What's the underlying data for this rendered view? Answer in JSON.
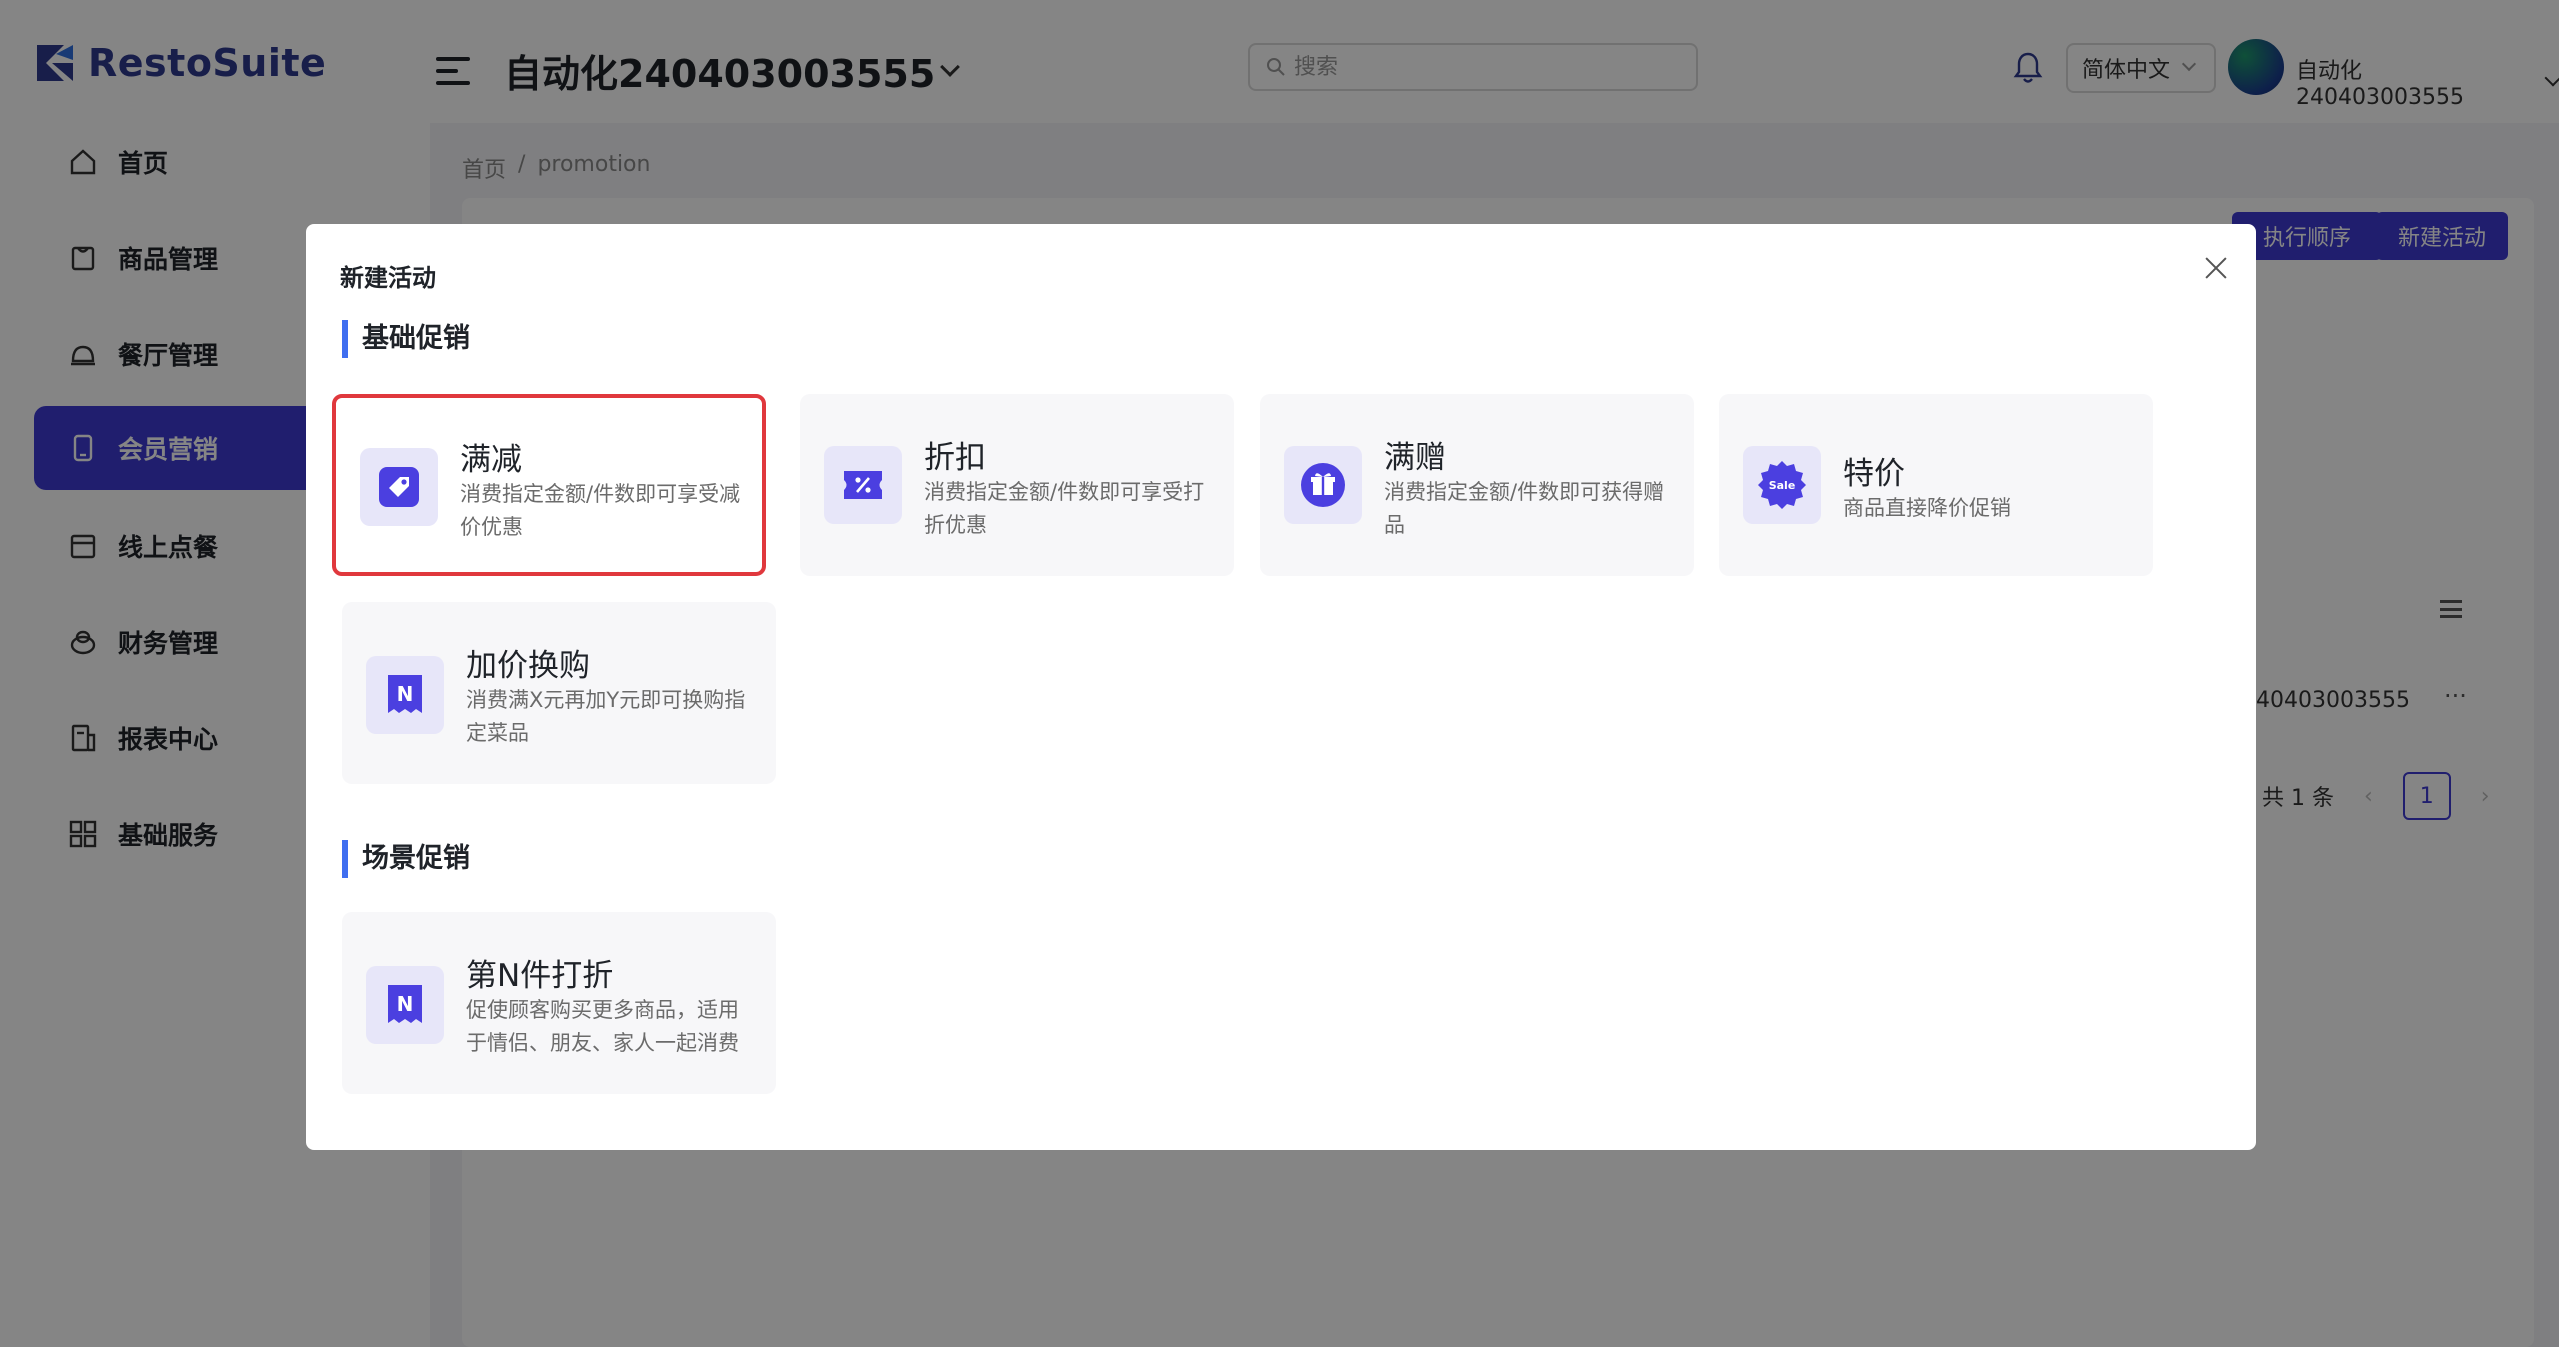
{
  "app": {
    "logo_text": "RestoSuite"
  },
  "header": {
    "store_title": "自动化240403003555",
    "search_placeholder": "搜索",
    "language": "简体中文",
    "user_name": "自动化240403003555"
  },
  "sidebar": {
    "items": [
      {
        "label": "首页",
        "icon": "home-icon"
      },
      {
        "label": "商品管理",
        "icon": "product-icon"
      },
      {
        "label": "餐厅管理",
        "icon": "restaurant-icon"
      },
      {
        "label": "会员营销",
        "icon": "member-icon",
        "active": true
      },
      {
        "label": "线上点餐",
        "icon": "online-order-icon"
      },
      {
        "label": "财务管理",
        "icon": "finance-icon"
      },
      {
        "label": "报表中心",
        "icon": "report-icon"
      },
      {
        "label": "基础服务",
        "icon": "grid-icon"
      }
    ]
  },
  "breadcrumb": {
    "home": "首页",
    "separator": "/",
    "current": "promotion"
  },
  "page": {
    "exec_order_label": "执行顺序",
    "new_activity_label": "新建活动",
    "row_store": "240403003555",
    "row_more": "···",
    "total_label": "共 1 条",
    "current_page": "1"
  },
  "modal": {
    "title": "新建活动",
    "sections": [
      {
        "title": "基础促销",
        "cards": [
          {
            "title": "满减",
            "desc": "消费指定金额/件数即可享受减价优惠",
            "icon": "price-tag-icon",
            "selected": true
          },
          {
            "title": "折扣",
            "desc": "消费指定金额/件数即可享受打折优惠",
            "icon": "percent-coupon-icon"
          },
          {
            "title": "满赠",
            "desc": "消费指定金额/件数即可获得赠品",
            "icon": "gift-icon"
          },
          {
            "title": "特价",
            "desc": "商品直接降价促销",
            "icon": "sale-badge-icon",
            "icon_text": "Sale"
          },
          {
            "title": "加价换购",
            "desc": "消费满X元再加Y元即可换购指定菜品",
            "icon": "n-ticket-icon",
            "icon_text": "N"
          }
        ]
      },
      {
        "title": "场景促销",
        "cards": [
          {
            "title": "第N件打折",
            "desc": "促使顾客购买更多商品，适用于情侣、朋友、家人一起消费",
            "icon": "n-ticket-icon",
            "icon_text": "N"
          }
        ]
      }
    ]
  },
  "colors": {
    "primary": "#3f3bd3",
    "selected_border": "#e0383d",
    "section_bar": "#3f6ef0",
    "icon_bg": "#e7e6f9"
  }
}
